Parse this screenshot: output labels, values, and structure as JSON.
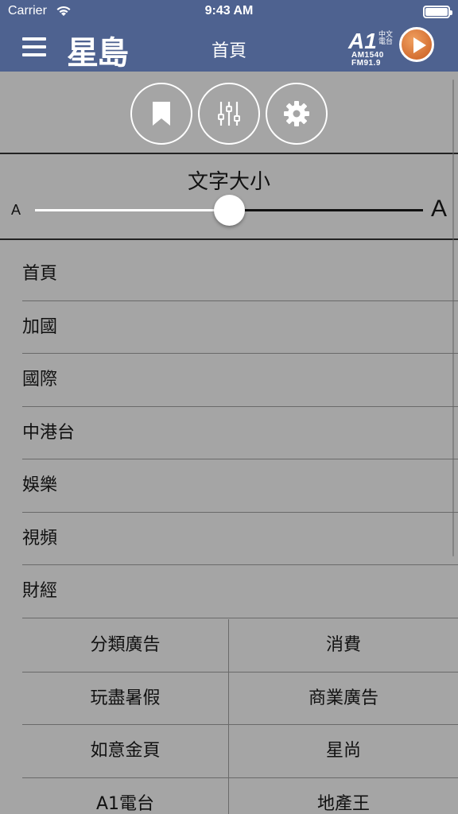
{
  "status_bar": {
    "carrier": "Carrier",
    "time": "9:43 AM"
  },
  "nav_bar": {
    "logo": "星島",
    "title": "首頁",
    "radio": {
      "brand": "A1",
      "chinese": "中文電台",
      "am": "AM1540",
      "fm": "FM91.9"
    }
  },
  "toolbar": {
    "icons": [
      "bookmark-icon",
      "equalizer-icon",
      "gear-icon"
    ]
  },
  "font_size": {
    "title": "文字大小",
    "small_label": "A",
    "large_label": "A",
    "slider_value": 0.5
  },
  "menu": {
    "items": [
      "首頁",
      "加國",
      "國際",
      "中港台",
      "娛樂",
      "視頻",
      "財經"
    ]
  },
  "grid": {
    "rows": [
      [
        "分類廣告",
        "消費"
      ],
      [
        "玩盡暑假",
        "商業廣告"
      ],
      [
        "如意金頁",
        "星尚"
      ],
      [
        "A1電台",
        "地產王"
      ]
    ]
  },
  "colors": {
    "nav": "#4e6290",
    "background": "#a5a5a5",
    "accent": "#c85a1e"
  }
}
